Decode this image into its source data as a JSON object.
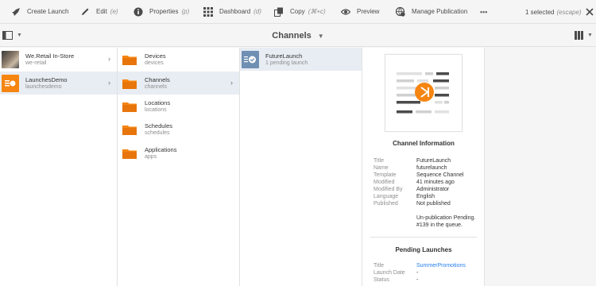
{
  "toolbar": {
    "create_launch": "Create Launch",
    "edit": "Edit",
    "edit_shortcut": "(e)",
    "properties": "Properties",
    "properties_shortcut": "(p)",
    "dashboard": "Dashboard",
    "dashboard_shortcut": "(d)",
    "copy": "Copy",
    "copy_shortcut": "(⌘+c)",
    "preview": "Preview",
    "manage_publication": "Manage Publication",
    "more": "•••",
    "selected": "1 selected",
    "selected_shortcut": "(escape)"
  },
  "header": {
    "title": "Channels"
  },
  "column1": [
    {
      "title": "We.Retail In-Store",
      "subtitle": "we-retail"
    },
    {
      "title": "LaunchesDemo",
      "subtitle": "launchesdemo"
    }
  ],
  "column2": [
    {
      "title": "Devices",
      "subtitle": "devices"
    },
    {
      "title": "Channels",
      "subtitle": "channels"
    },
    {
      "title": "Locations",
      "subtitle": "locations"
    },
    {
      "title": "Schedules",
      "subtitle": "schedules"
    },
    {
      "title": "Applications",
      "subtitle": "apps"
    }
  ],
  "column3": [
    {
      "title": "FutureLaunch",
      "subtitle": "1 pending launch"
    }
  ],
  "details": {
    "section_title": "Channel Information",
    "properties": [
      {
        "key": "Title",
        "value": "FutureLaunch"
      },
      {
        "key": "Name",
        "value": "futurelaunch"
      },
      {
        "key": "Template",
        "value": "Sequence Channel"
      },
      {
        "key": "Modified",
        "value": "41 minutes ago"
      },
      {
        "key": "Modified By",
        "value": "Administrator"
      },
      {
        "key": "Language",
        "value": "English"
      },
      {
        "key": "Published",
        "value": "Not published"
      }
    ],
    "publication_note": "Un-publication Pending. #139 in the queue.",
    "pending_title": "Pending Launches",
    "pending": [
      {
        "key": "Title",
        "value": "SummerPromotions"
      },
      {
        "key": "Launch Date",
        "value": "-"
      },
      {
        "key": "Status",
        "value": "-"
      }
    ]
  },
  "colors": {
    "accent": "#2680eb",
    "folder": "#f68511",
    "selected_row": "#e8edf3"
  }
}
